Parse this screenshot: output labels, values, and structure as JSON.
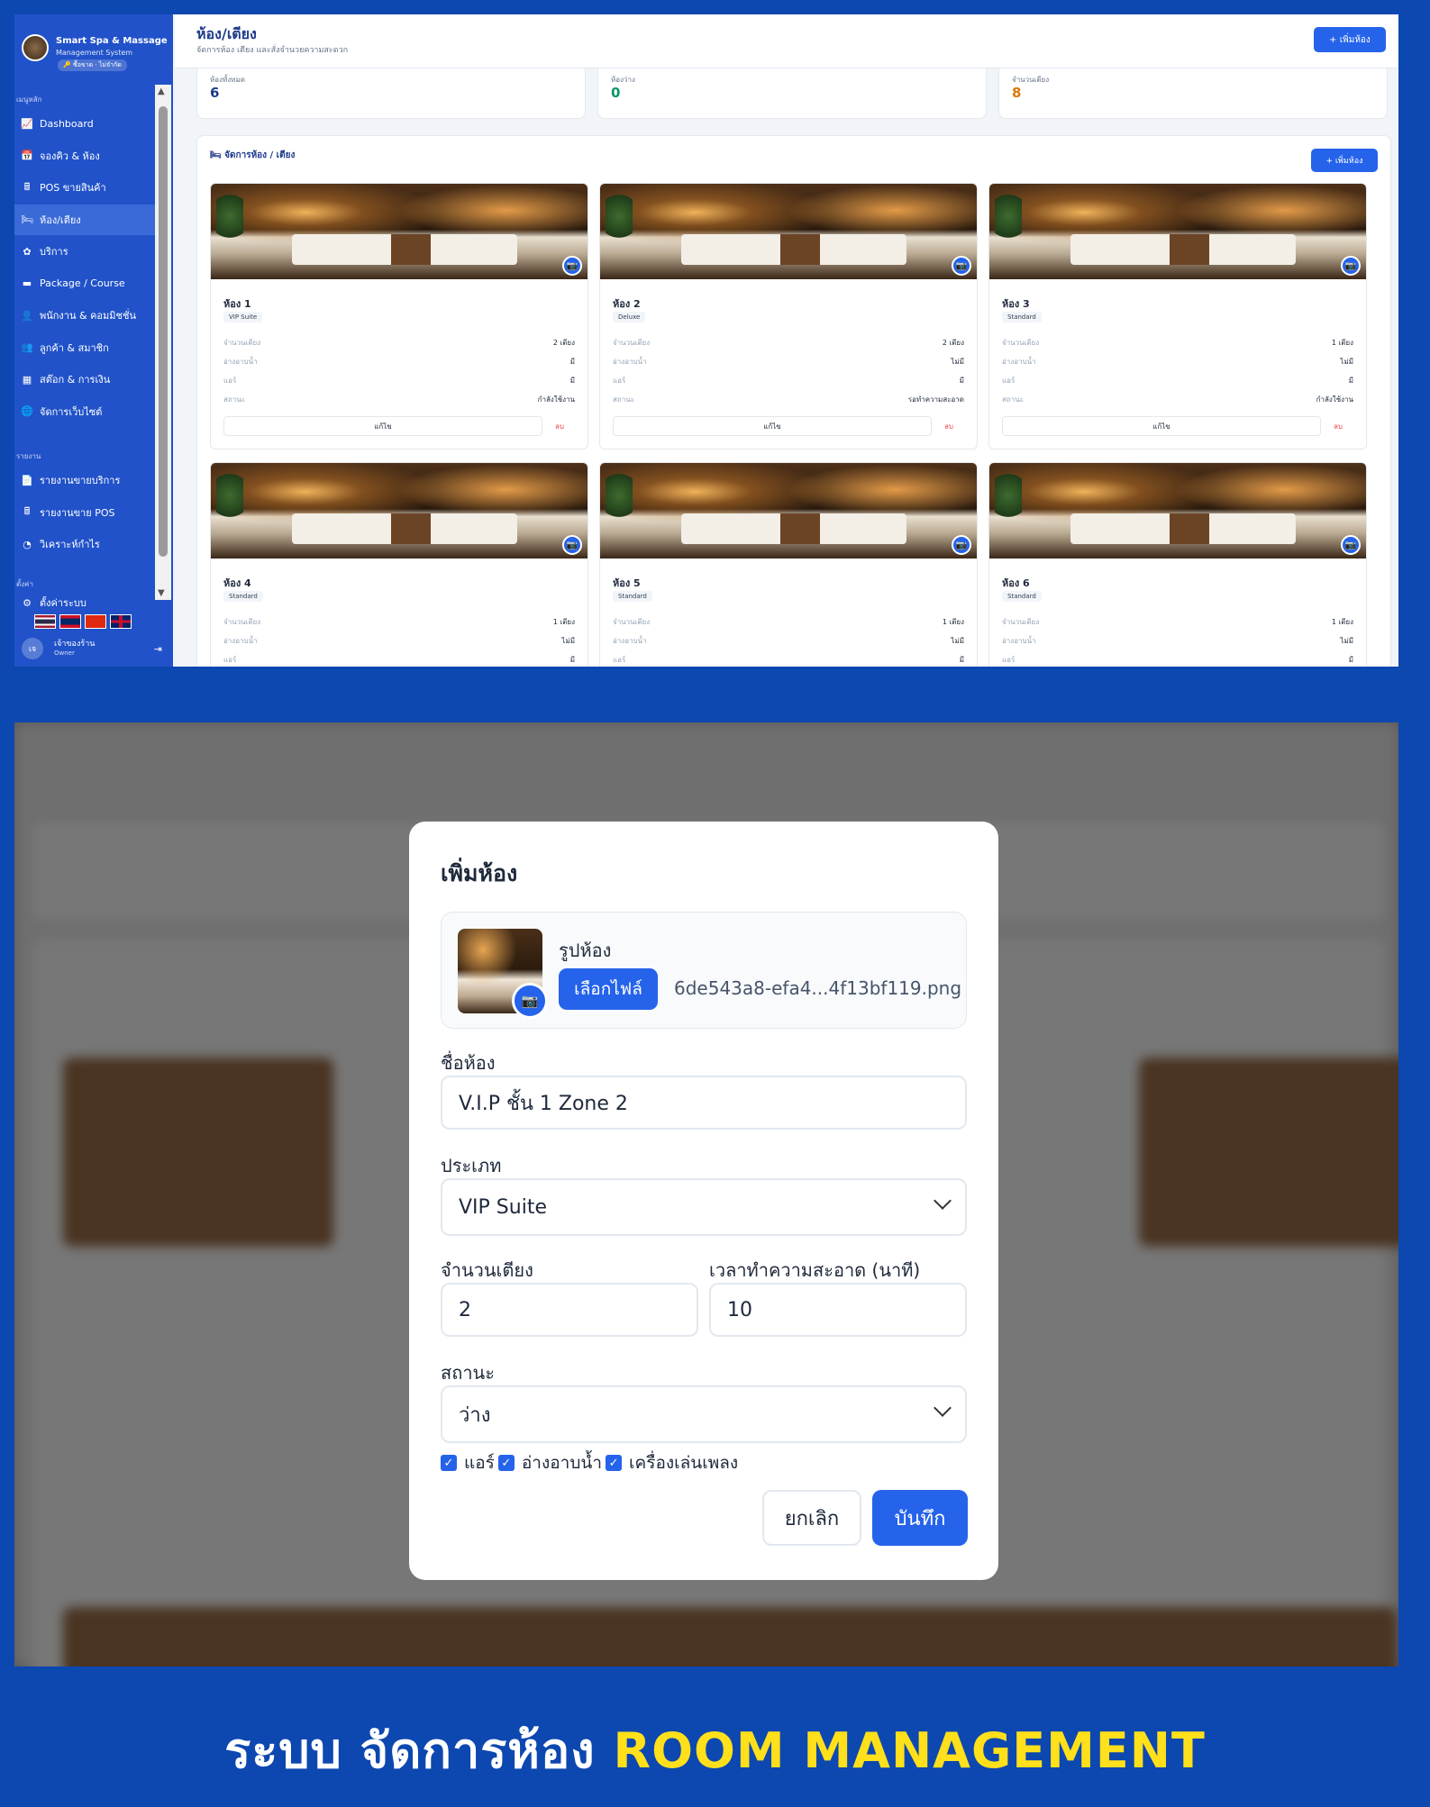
{
  "app": {
    "name": "Smart Spa & Massage",
    "subtitle": "Management System",
    "tag": "🔑 ซื้อขาด · ไม่จำกัด"
  },
  "sidebar": {
    "section_main": "เมนูหลัก",
    "section_reports": "รายงาน",
    "section_settings": "ตั้งค่า",
    "items": [
      {
        "label": "Dashboard",
        "icon": "chart-line-icon"
      },
      {
        "label": "จองคิว & ห้อง",
        "icon": "calendar-icon"
      },
      {
        "label": "POS ขายสินค้า",
        "icon": "register-icon"
      },
      {
        "label": "ห้อง/เตียง",
        "icon": "bed-icon"
      },
      {
        "label": "บริการ",
        "icon": "lotus-icon"
      },
      {
        "label": "Package / Course",
        "icon": "card-icon"
      },
      {
        "label": "พนักงาน & คอมมิชชั่น",
        "icon": "user-icon"
      },
      {
        "label": "ลูกค้า & สมาชิก",
        "icon": "users-icon"
      },
      {
        "label": "สต๊อก & การเงิน",
        "icon": "warehouse-icon"
      },
      {
        "label": "จัดการเว็บไซต์",
        "icon": "globe-icon"
      }
    ],
    "reports": [
      {
        "label": "รายงานขายบริการ",
        "icon": "file-icon"
      },
      {
        "label": "รายงานขาย POS",
        "icon": "register-icon"
      },
      {
        "label": "วิเคราะห์กำไร",
        "icon": "pie-icon"
      }
    ],
    "settings_partial": "ตั้งค่าระบบ",
    "user": {
      "initials": "เจ",
      "name": "เจ้าของร้าน",
      "role": "Owner"
    }
  },
  "header": {
    "title": "ห้อง/เตียง",
    "subtitle": "จัดการห้อง เตียง และสั่งจำนวยความสะดวก",
    "add_button": "+ เพิ่มห้อง"
  },
  "stats": [
    {
      "label": "ห้องทั้งหมด",
      "value": "6",
      "color": "#1e3a8a"
    },
    {
      "label": "ห้องว่าง",
      "value": "0",
      "color": "#059669"
    },
    {
      "label": "จำนวนเตียง",
      "value": "8",
      "color": "#d97706"
    }
  ],
  "panel": {
    "title": "🛏 จัดการห้อง / เตียง",
    "add_button": "+ เพิ่มห้อง"
  },
  "field_labels": {
    "beds": "จำนวนเตียง",
    "bath": "อ่างอาบน้ำ",
    "air": "แอร์",
    "status": "สถานะ"
  },
  "card_actions": {
    "edit": "แก้ไข",
    "delete": "ลบ"
  },
  "rooms": [
    {
      "name": "ห้อง 1",
      "type": "VIP Suite",
      "beds": "2 เตียง",
      "bath": "มี",
      "air": "มี",
      "status": "กำลังใช้งาน"
    },
    {
      "name": "ห้อง 2",
      "type": "Deluxe",
      "beds": "2 เตียง",
      "bath": "ไม่มี",
      "air": "มี",
      "status": "รอทำความสะอาด"
    },
    {
      "name": "ห้อง 3",
      "type": "Standard",
      "beds": "1 เตียง",
      "bath": "ไม่มี",
      "air": "มี",
      "status": "กำลังใช้งาน"
    },
    {
      "name": "ห้อง 4",
      "type": "Standard",
      "beds": "1 เตียง",
      "bath": "ไม่มี",
      "air": "มี",
      "status": ""
    },
    {
      "name": "ห้อง 5",
      "type": "Standard",
      "beds": "1 เตียง",
      "bath": "ไม่มี",
      "air": "มี",
      "status": ""
    },
    {
      "name": "ห้อง 6",
      "type": "Standard",
      "beds": "1 เตียง",
      "bath": "ไม่มี",
      "air": "มี",
      "status": ""
    }
  ],
  "modal": {
    "title": "เพิ่มห้อง",
    "upload_label": "รูปห้อง",
    "choose_file": "เลือกไฟล์",
    "file_name": "6de543a8-efa4...4f13bf119.png",
    "name_label": "ชื่อห้อง",
    "name_value": "V.I.P ชั้น 1 Zone 2",
    "type_label": "ประเภท",
    "type_value": "VIP Suite",
    "beds_label": "จำนวนเตียง",
    "beds_value": "2",
    "clean_label": "เวลาทำความสะอาด (นาที)",
    "clean_value": "10",
    "status_label": "สถานะ",
    "status_value": "ว่าง",
    "check_air": "แอร์",
    "check_bath": "อ่างอาบน้ำ",
    "check_music": "เครื่องเล่นเพลง",
    "cancel": "ยกเลิก",
    "save": "บันทึก"
  },
  "footer": {
    "thai": "ระบบ จัดการห้อง",
    "english": "ROOM MANAGEMENT"
  },
  "colors": {
    "primary": "#2563eb",
    "sidebar": "#2152c9",
    "background": "#0d47b0",
    "highlight": "#ffe01a"
  }
}
